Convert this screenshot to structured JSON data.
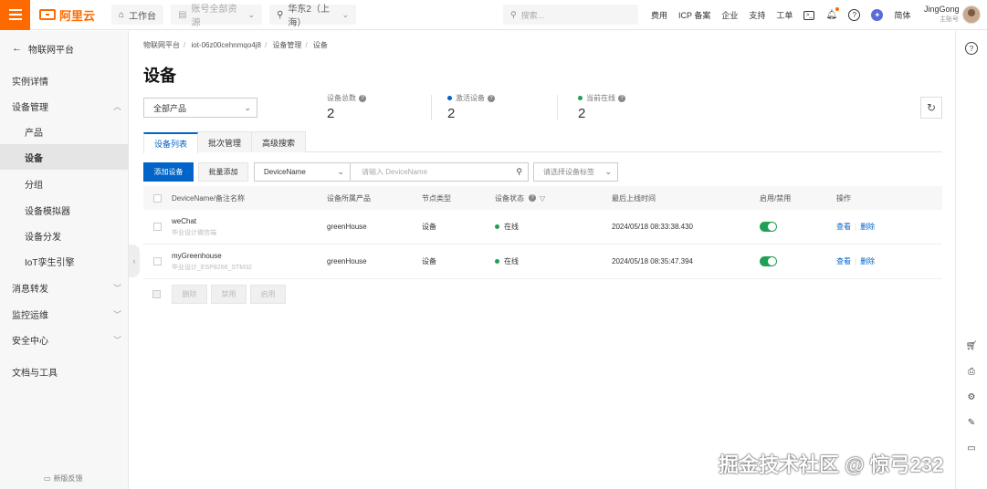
{
  "topbar": {
    "logo_text": "阿里云",
    "workbench_label": "工作台",
    "account_label": "账号全部资源",
    "region_label": "华东2（上海）",
    "search_placeholder": "搜索...",
    "links": [
      "费用",
      "ICP 备案",
      "企业",
      "支持",
      "工单"
    ],
    "language": "简体",
    "user_name": "JingGong",
    "user_role": "主账号"
  },
  "sidebar": {
    "back_label": "物联网平台",
    "items": [
      {
        "label": "实例详情",
        "type": "top"
      },
      {
        "label": "设备管理",
        "type": "top",
        "chevron": "up"
      },
      {
        "label": "产品",
        "type": "sub"
      },
      {
        "label": "设备",
        "type": "sub",
        "active": true
      },
      {
        "label": "分组",
        "type": "sub"
      },
      {
        "label": "设备模拟器",
        "type": "sub"
      },
      {
        "label": "设备分发",
        "type": "sub"
      },
      {
        "label": "IoT孪生引擎",
        "type": "sub"
      },
      {
        "label": "消息转发",
        "type": "top",
        "chevron": "down"
      },
      {
        "label": "监控运维",
        "type": "top",
        "chevron": "down"
      },
      {
        "label": "安全中心",
        "type": "top",
        "chevron": "down"
      },
      {
        "label": "文档与工具",
        "type": "top"
      }
    ],
    "feedback_label": "新版反馈"
  },
  "main": {
    "breadcrumb": [
      "物联网平台",
      "iot-06z00cehnmqo4j8",
      "设备管理",
      "设备"
    ],
    "title": "设备",
    "product_select": "全部产品",
    "stats": [
      {
        "label": "设备总数",
        "value": "2",
        "dot": ""
      },
      {
        "label": "激活设备",
        "value": "2",
        "dot": "#0064c8"
      },
      {
        "label": "当前在线",
        "value": "2",
        "dot": "#1fa056"
      }
    ],
    "tabs": [
      {
        "label": "设备列表",
        "active": true
      },
      {
        "label": "批次管理",
        "active": false
      },
      {
        "label": "高级搜索",
        "active": false
      }
    ],
    "toolbar": {
      "add_label": "添加设备",
      "batch_add_label": "批量添加",
      "field_select": "DeviceName",
      "search_placeholder": "请输入 DeviceName",
      "tag_placeholder": "请选择设备标签"
    },
    "table": {
      "headers": [
        "DeviceName/备注名称",
        "设备所属产品",
        "节点类型",
        "设备状态",
        "最后上线时间",
        "启用/禁用",
        "操作"
      ],
      "rows": [
        {
          "name": "weChat",
          "note": "毕业设计微信端",
          "product": "greenHouse",
          "node_type": "设备",
          "status": "在线",
          "last_online": "2024/05/18 08:33:38.430",
          "enabled": true,
          "view": "查看",
          "delete": "删除"
        },
        {
          "name": "myGreenhouse",
          "note": "毕业设计_ESP8266_STM32",
          "product": "greenHouse",
          "node_type": "设备",
          "status": "在线",
          "last_online": "2024/05/18 08:35:47.394",
          "enabled": true,
          "view": "查看",
          "delete": "删除"
        }
      ]
    },
    "bulk_actions": [
      "删除",
      "禁用",
      "启用"
    ]
  },
  "watermark": "掘金技术社区 @ 惊弓232",
  "colors": {
    "accent": "#ff6a00",
    "primary": "#0064c8",
    "online": "#1fa056"
  }
}
